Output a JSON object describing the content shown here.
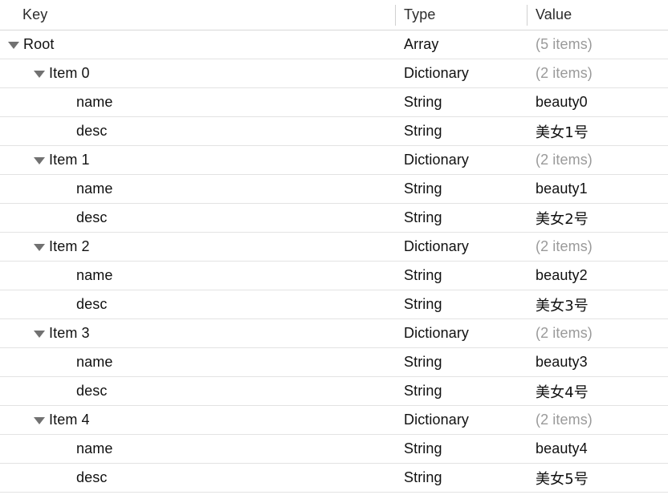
{
  "columns": {
    "key_label": "Key",
    "type_label": "Type",
    "value_label": "Value"
  },
  "colors": {
    "text": "#111111",
    "muted_text": "#9a9a9a",
    "header_text": "#2b2b2b",
    "row_separator": "#e3e3e3",
    "header_separator": "#d8d8d8",
    "column_divider": "#d0d0d0",
    "twisty": "#717171",
    "background": "#ffffff"
  },
  "rows": [
    {
      "key": "Root",
      "level": 0,
      "expanded": true,
      "twisty": "disclosure-triangle-expanded-icon",
      "type": "Array",
      "value": "(5 items)",
      "value_muted": true
    },
    {
      "key": "Item 0",
      "level": 1,
      "expanded": true,
      "twisty": "disclosure-triangle-expanded-icon",
      "type": "Dictionary",
      "value": "(2 items)",
      "value_muted": true
    },
    {
      "key": "name",
      "level": 2,
      "expanded": false,
      "twisty": null,
      "type": "String",
      "value": "beauty0",
      "value_muted": false
    },
    {
      "key": "desc",
      "level": 2,
      "expanded": false,
      "twisty": null,
      "type": "String",
      "value": "美女1号",
      "value_muted": false
    },
    {
      "key": "Item 1",
      "level": 1,
      "expanded": true,
      "twisty": "disclosure-triangle-expanded-icon",
      "type": "Dictionary",
      "value": "(2 items)",
      "value_muted": true
    },
    {
      "key": "name",
      "level": 2,
      "expanded": false,
      "twisty": null,
      "type": "String",
      "value": "beauty1",
      "value_muted": false
    },
    {
      "key": "desc",
      "level": 2,
      "expanded": false,
      "twisty": null,
      "type": "String",
      "value": "美女2号",
      "value_muted": false
    },
    {
      "key": "Item 2",
      "level": 1,
      "expanded": true,
      "twisty": "disclosure-triangle-expanded-icon",
      "type": "Dictionary",
      "value": "(2 items)",
      "value_muted": true
    },
    {
      "key": "name",
      "level": 2,
      "expanded": false,
      "twisty": null,
      "type": "String",
      "value": "beauty2",
      "value_muted": false
    },
    {
      "key": "desc",
      "level": 2,
      "expanded": false,
      "twisty": null,
      "type": "String",
      "value": "美女3号",
      "value_muted": false
    },
    {
      "key": "Item 3",
      "level": 1,
      "expanded": true,
      "twisty": "disclosure-triangle-expanded-icon",
      "type": "Dictionary",
      "value": "(2 items)",
      "value_muted": true
    },
    {
      "key": "name",
      "level": 2,
      "expanded": false,
      "twisty": null,
      "type": "String",
      "value": "beauty3",
      "value_muted": false
    },
    {
      "key": "desc",
      "level": 2,
      "expanded": false,
      "twisty": null,
      "type": "String",
      "value": "美女4号",
      "value_muted": false
    },
    {
      "key": "Item 4",
      "level": 1,
      "expanded": true,
      "twisty": "disclosure-triangle-expanded-icon",
      "type": "Dictionary",
      "value": "(2 items)",
      "value_muted": true
    },
    {
      "key": "name",
      "level": 2,
      "expanded": false,
      "twisty": null,
      "type": "String",
      "value": "beauty4",
      "value_muted": false
    },
    {
      "key": "desc",
      "level": 2,
      "expanded": false,
      "twisty": null,
      "type": "String",
      "value": "美女5号",
      "value_muted": false
    }
  ]
}
